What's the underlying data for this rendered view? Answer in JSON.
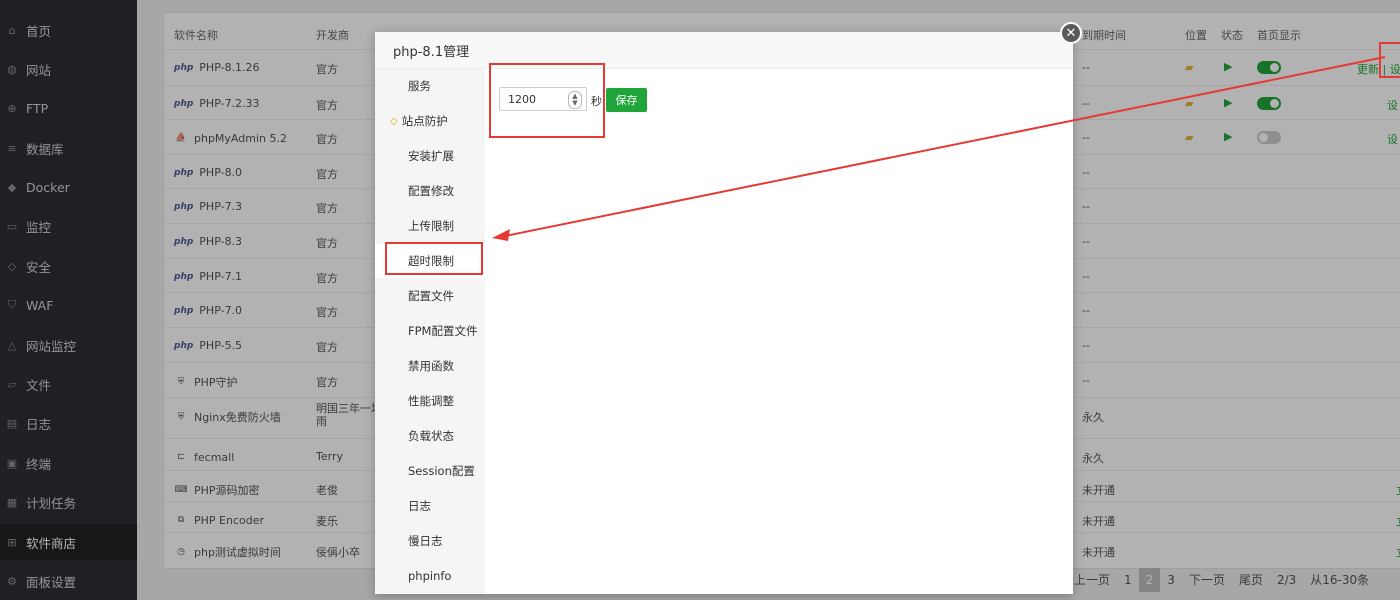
{
  "sidebar": {
    "items": [
      {
        "label": "首页",
        "icon": "home-icon"
      },
      {
        "label": "网站",
        "icon": "globe-icon"
      },
      {
        "label": "FTP",
        "icon": "ftp-icon"
      },
      {
        "label": "数据库",
        "icon": "database-icon"
      },
      {
        "label": "Docker",
        "icon": "docker-icon"
      },
      {
        "label": "监控",
        "icon": "monitor-icon"
      },
      {
        "label": "安全",
        "icon": "shield-icon"
      },
      {
        "label": "WAF",
        "icon": "waf-icon"
      },
      {
        "label": "网站监控",
        "icon": "chart-icon"
      },
      {
        "label": "文件",
        "icon": "folder-icon"
      },
      {
        "label": "日志",
        "icon": "log-icon"
      },
      {
        "label": "终端",
        "icon": "terminal-icon"
      },
      {
        "label": "计划任务",
        "icon": "calendar-icon"
      },
      {
        "label": "软件商店",
        "icon": "grid-icon",
        "active": true
      },
      {
        "label": "面板设置",
        "icon": "gear-icon"
      }
    ]
  },
  "table": {
    "headers": {
      "name": "软件名称",
      "dev": "开发商",
      "expire": "到期时间",
      "location": "位置",
      "status": "状态",
      "home": "首页显示"
    },
    "rows": [
      {
        "name": "PHP-8.1.26",
        "dev": "官方",
        "expire": "--",
        "logo": "php",
        "toggle": "on",
        "action": "更新 | 设"
      },
      {
        "name": "PHP-7.2.33",
        "dev": "官方",
        "expire": "--",
        "logo": "php",
        "toggle": "on",
        "action": "设"
      },
      {
        "name": "phpMyAdmin 5.2",
        "dev": "官方",
        "expire": "--",
        "logo": "pma",
        "toggle": "off",
        "action": "设"
      },
      {
        "name": "PHP-8.0",
        "dev": "官方",
        "expire": "--",
        "logo": "php"
      },
      {
        "name": "PHP-7.3",
        "dev": "官方",
        "expire": "--",
        "logo": "php"
      },
      {
        "name": "PHP-8.3",
        "dev": "官方",
        "expire": "--",
        "logo": "php"
      },
      {
        "name": "PHP-7.1",
        "dev": "官方",
        "expire": "--",
        "logo": "php"
      },
      {
        "name": "PHP-7.0",
        "dev": "官方",
        "expire": "--",
        "logo": "php"
      },
      {
        "name": "PHP-5.5",
        "dev": "官方",
        "expire": "--",
        "logo": "php"
      },
      {
        "name": "PHP守护",
        "dev": "官方",
        "expire": "--",
        "logo": "guard"
      },
      {
        "name": "Nginx免费防火墙",
        "dev": "明国三年一场雨",
        "expire": "永久",
        "logo": "waf"
      },
      {
        "name": "fecmall",
        "dev": "Terry",
        "expire": "永久",
        "logo": "fec"
      },
      {
        "name": "PHP源码加密",
        "dev": "老俊",
        "expire": "未开通",
        "logo": "enc",
        "action": "立"
      },
      {
        "name": "PHP Encoder",
        "dev": "麦乐",
        "expire": "未开通",
        "logo": "encoder",
        "action": "立"
      },
      {
        "name": "php测试虚拟时间",
        "dev": "佞偁小卒",
        "expire": "未开通",
        "logo": "clock",
        "action": "立"
      }
    ]
  },
  "pager": {
    "items": [
      "上一页",
      "1",
      "2",
      "3",
      "下一页",
      "尾页",
      "2/3",
      "从16-30条"
    ],
    "current": "2"
  },
  "modal": {
    "title": "php-8.1管理",
    "close_icon": "close-icon",
    "tabs": [
      {
        "label": "服务"
      },
      {
        "label": "站点防护",
        "icon": "diamond-icon"
      },
      {
        "label": "安装扩展"
      },
      {
        "label": "配置修改"
      },
      {
        "label": "上传限制"
      },
      {
        "label": "超时限制",
        "selected": true
      },
      {
        "label": "配置文件"
      },
      {
        "label": "FPM配置文件"
      },
      {
        "label": "禁用函数"
      },
      {
        "label": "性能调整"
      },
      {
        "label": "负载状态"
      },
      {
        "label": "Session配置"
      },
      {
        "label": "日志"
      },
      {
        "label": "慢日志"
      },
      {
        "label": "phpinfo"
      }
    ],
    "timeout": {
      "value": "1200",
      "unit": "秒",
      "save_label": "保存"
    }
  },
  "colors": {
    "accent": "#20a53a",
    "annotation": "#e53935",
    "sidebar": "#2b2f33"
  }
}
